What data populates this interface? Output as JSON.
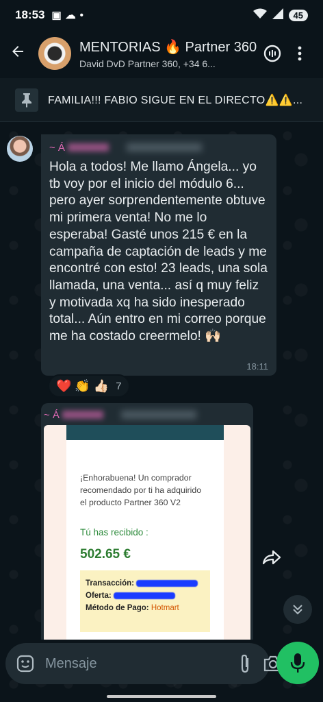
{
  "status_bar": {
    "time": "18:53",
    "battery": "45"
  },
  "header": {
    "back_icon": "back-arrow-icon",
    "title": "MENTORIAS 🔥 Partner 360",
    "subtitle": "David DvD Partner 360, +34 6..."
  },
  "pinned": {
    "text": "FAMILIA!!! FABIO SIGUE EN EL DIRECTO⚠️⚠️..."
  },
  "messages": [
    {
      "sender": "~ Á",
      "text": "Hola a todos! Me llamo Ángela... yo tb voy por el inicio del módulo 6... pero ayer sorprendentemente obtuve mi primera venta! No me lo esperaba! Gasté unos 215 € en la campaña de captación de leads y me  encontré con esto! 23 leads, una sola llamada, una venta... así q muy feliz y motivada xq ha sido inesperado total... Aún entro en mi correo porque me ha costado creermelo! 🙌🏻",
      "time": "18:11",
      "reactions": "❤️ 👏 👍🏻",
      "reaction_count": "7"
    },
    {
      "sender": "~ Á",
      "doc": {
        "intro": "¡Enhorabuena! Un comprador recomendado por ti ha adquirido el producto Partner 360 V2",
        "received_label": "Tú has recibido :",
        "amount": "502.65 €",
        "transaction_label": "Transacción:",
        "offer_label": "Oferta:",
        "payment_label": "Método de Pago:",
        "payment_value": "Hotmart"
      }
    }
  ],
  "composer": {
    "placeholder": "Mensaje"
  },
  "colors": {
    "accent": "#21c063",
    "sender": "#e26ab6",
    "bubble": "#202c33"
  }
}
